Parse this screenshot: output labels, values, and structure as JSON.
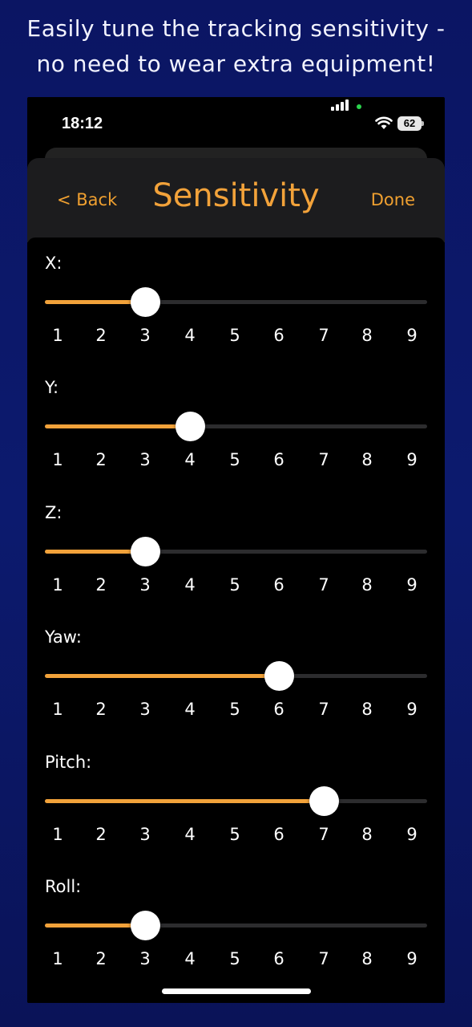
{
  "caption": {
    "line1": "Easily tune the tracking sensitivity -",
    "line2": "no need to wear extra equipment!"
  },
  "status_bar": {
    "time": "18:12",
    "battery": "62",
    "icons": [
      "signal-icon",
      "wifi-icon",
      "battery-icon"
    ]
  },
  "nav": {
    "back_label": "< Back",
    "title": "Sensitivity",
    "done_label": "Done"
  },
  "colors": {
    "accent": "#f2a23a",
    "background": "#000000",
    "outer_background": "#0b1563"
  },
  "sliders": [
    {
      "key": "x",
      "label": "X:",
      "value": 3
    },
    {
      "key": "y",
      "label": "Y:",
      "value": 4
    },
    {
      "key": "z",
      "label": "Z:",
      "value": 3
    },
    {
      "key": "yaw",
      "label": "Yaw:",
      "value": 6
    },
    {
      "key": "pitch",
      "label": "Pitch:",
      "value": 7
    },
    {
      "key": "roll",
      "label": "Roll:",
      "value": 3
    }
  ],
  "scale": {
    "min": 1,
    "max": 9,
    "ticks": [
      "1",
      "2",
      "3",
      "4",
      "5",
      "6",
      "7",
      "8",
      "9"
    ]
  }
}
